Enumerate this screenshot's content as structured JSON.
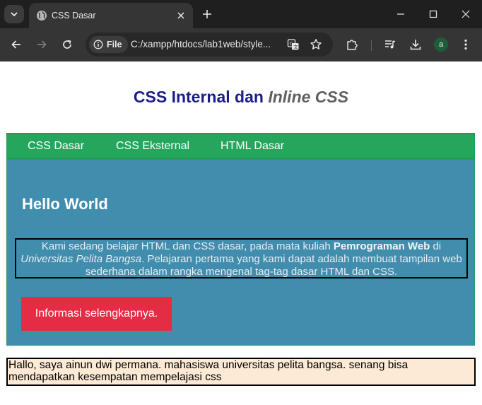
{
  "browser": {
    "tab": {
      "title": "CSS Dasar"
    },
    "address": {
      "chip_label": "File",
      "url": "C:/xampp/htdocs/lab1web/style..."
    },
    "profile_initial": "a"
  },
  "page": {
    "title_main": "CSS Internal dan ",
    "title_em": "Inline CSS",
    "nav": [
      "CSS Dasar",
      "CSS Eksternal",
      "HTML Dasar"
    ],
    "heading": "Hello World",
    "paragraph": {
      "text1": "Kami sedang belajar HTML dan CSS dasar, pada mata kuliah ",
      "bold": "Pemrograman Web",
      "text2": " di ",
      "italic": "Universitas Pelita Bangsa",
      "text3": ". Pelajaran pertama yang kami dapat adalah membuat tampilan web sederhana dalam rangka mengenal tag-tag dasar HTML dan CSS."
    },
    "button_label": "Informasi selengkapnya.",
    "footer_text": "Hallo, saya ainun dwi permana. mahasiswa universitas pelita bangsa. senang bisa mendapatkan kesempatan mempelajasi css"
  },
  "colors": {
    "nav_bg": "#24a65d",
    "content_bg": "#418dae",
    "button_bg": "#e52c45",
    "title": "#1c1c8c",
    "footer_bg": "#fcead4"
  }
}
